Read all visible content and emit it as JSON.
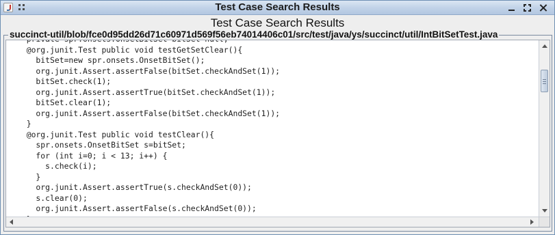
{
  "window": {
    "title": "Test Case Search Results",
    "icons": [
      "java-icon",
      "grip-icon",
      "minimize-icon",
      "maximize-icon",
      "close-icon"
    ]
  },
  "heading": "Test Case Search Results",
  "file_path": "succinct-util/blob/fce0d95dd26d71c60971d569f56eb74014406c01/src/test/java/ys/succinct/util/IntBitSetTest.java",
  "code_lines": [
    "  private spr.onsets.OnsetBitSet bitSet=null;",
    "  @org.junit.Test public void testGetSetClear(){",
    "    bitSet=new spr.onsets.OnsetBitSet();",
    "    org.junit.Assert.assertFalse(bitSet.checkAndSet(1));",
    "    bitSet.check(1);",
    "    org.junit.Assert.assertTrue(bitSet.checkAndSet(1));",
    "    bitSet.clear(1);",
    "    org.junit.Assert.assertFalse(bitSet.checkAndSet(1));",
    "  }",
    "  @org.junit.Test public void testClear(){",
    "    spr.onsets.OnsetBitSet s=bitSet;",
    "    for (int i=0; i < 13; i++) {",
    "      s.check(i);",
    "    }",
    "    org.junit.Assert.assertTrue(s.checkAndSet(0));",
    "    s.clear(0);",
    "    org.junit.Assert.assertFalse(s.checkAndSet(0));",
    "  }"
  ]
}
